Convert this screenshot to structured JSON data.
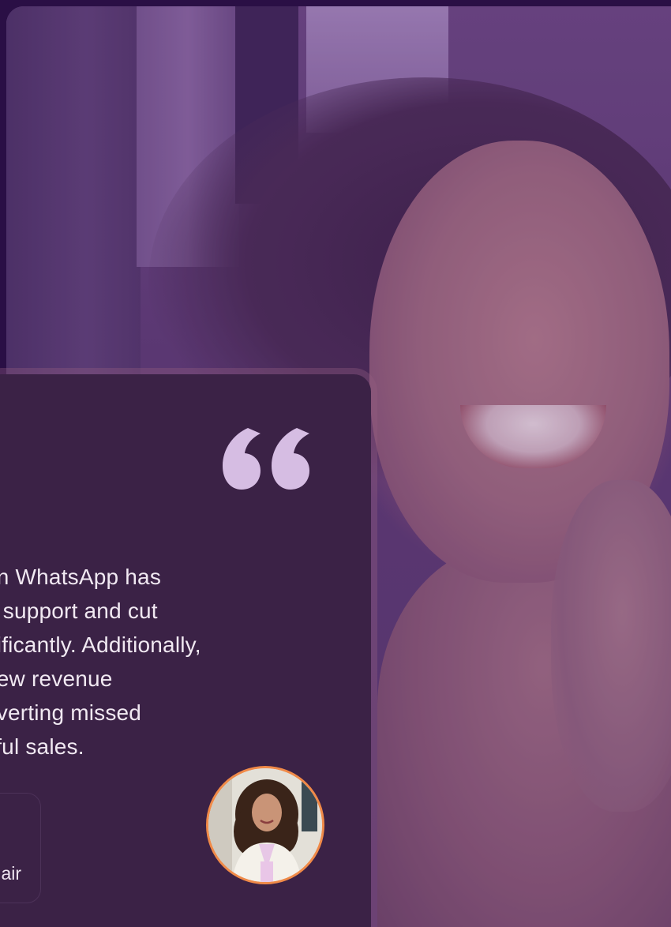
{
  "testimonial": {
    "quote_lines": [
      "on WhatsApp has",
      "e support and cut",
      "nificantly. Additionally,",
      "new revenue",
      "nverting missed",
      "sful sales."
    ],
    "attribution_role": "air"
  },
  "icons": {
    "quote": "quote-mark-icon",
    "avatar": "person-photo"
  },
  "colors": {
    "page_background": "#2a0f45",
    "card_background": "#3b2246",
    "quote_mark": "#d6bde3",
    "quote_text": "#f1e9f2",
    "avatar_border": "#f08a48"
  }
}
